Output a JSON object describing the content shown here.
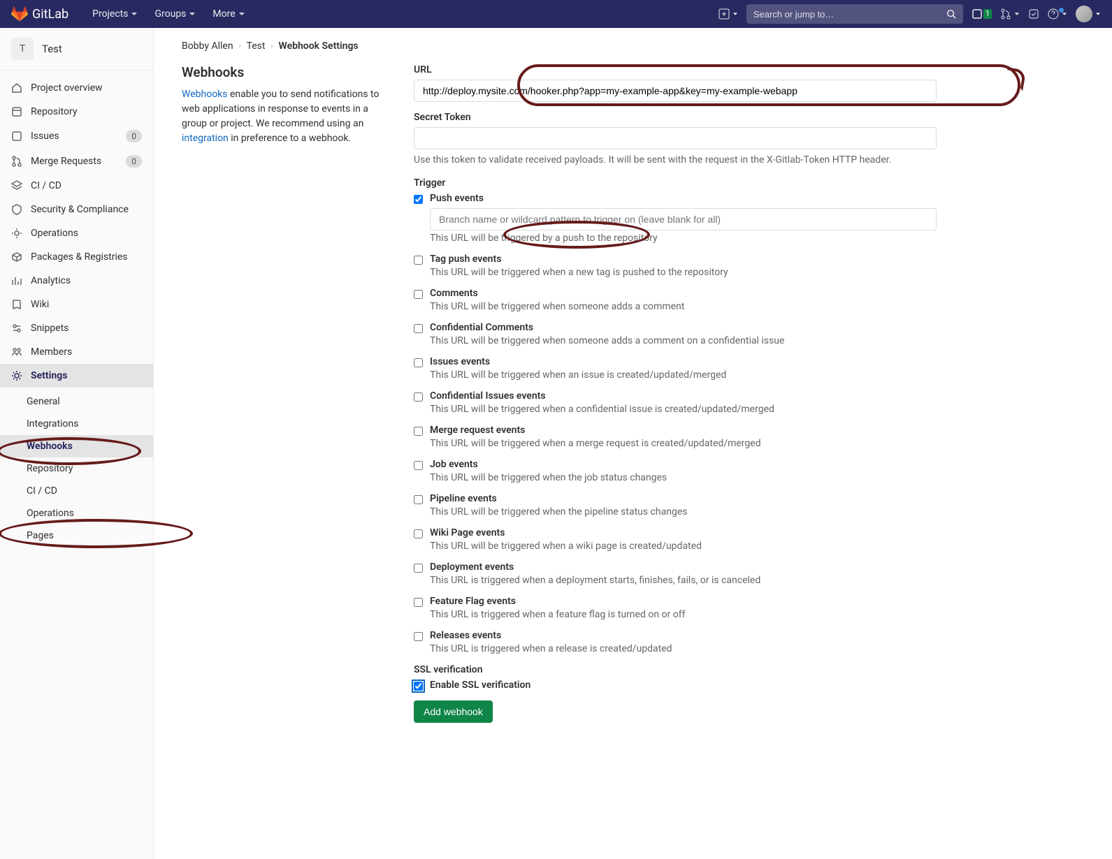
{
  "navbar": {
    "brand": "GitLab",
    "menu": [
      "Projects",
      "Groups",
      "More"
    ],
    "search_placeholder": "Search or jump to…",
    "todo_badge": "1"
  },
  "sidebar": {
    "project_initial": "T",
    "project_name": "Test",
    "items": [
      {
        "label": "Project overview",
        "badge": null
      },
      {
        "label": "Repository",
        "badge": null
      },
      {
        "label": "Issues",
        "badge": "0"
      },
      {
        "label": "Merge Requests",
        "badge": "0"
      },
      {
        "label": "CI / CD",
        "badge": null
      },
      {
        "label": "Security & Compliance",
        "badge": null
      },
      {
        "label": "Operations",
        "badge": null
      },
      {
        "label": "Packages & Registries",
        "badge": null
      },
      {
        "label": "Analytics",
        "badge": null
      },
      {
        "label": "Wiki",
        "badge": null
      },
      {
        "label": "Snippets",
        "badge": null
      },
      {
        "label": "Members",
        "badge": null
      },
      {
        "label": "Settings",
        "badge": null
      }
    ],
    "settings_sub": [
      "General",
      "Integrations",
      "Webhooks",
      "Repository",
      "CI / CD",
      "Operations",
      "Pages"
    ]
  },
  "breadcrumb": [
    "Bobby Allen",
    "Test",
    "Webhook Settings"
  ],
  "desc": {
    "heading": "Webhooks",
    "link1": "Webhooks",
    "text1": " enable you to send notifications to web applications in response to events in a group or project. We recommend using an ",
    "link2": "integration",
    "text2": " in preference to a webhook."
  },
  "form": {
    "url_label": "URL",
    "url_value": "http://deploy.mysite.com/hooker.php?app=my-example-app&key=my-example-webapp",
    "secret_label": "Secret Token",
    "secret_help": "Use this token to validate received payloads. It will be sent with the request in the X-Gitlab-Token HTTP header.",
    "trigger_label": "Trigger",
    "branch_placeholder": "Branch name or wildcard pattern to trigger on (leave blank for all)",
    "triggers": [
      {
        "label": "Push events",
        "desc": "This URL will be triggered by a push to the repository",
        "checked": true,
        "has_input": true
      },
      {
        "label": "Tag push events",
        "desc": "This URL will be triggered when a new tag is pushed to the repository",
        "checked": false
      },
      {
        "label": "Comments",
        "desc": "This URL will be triggered when someone adds a comment",
        "checked": false
      },
      {
        "label": "Confidential Comments",
        "desc": "This URL will be triggered when someone adds a comment on a confidential issue",
        "checked": false
      },
      {
        "label": "Issues events",
        "desc": "This URL will be triggered when an issue is created/updated/merged",
        "checked": false
      },
      {
        "label": "Confidential Issues events",
        "desc": "This URL will be triggered when a confidential issue is created/updated/merged",
        "checked": false
      },
      {
        "label": "Merge request events",
        "desc": "This URL will be triggered when a merge request is created/updated/merged",
        "checked": false
      },
      {
        "label": "Job events",
        "desc": "This URL will be triggered when the job status changes",
        "checked": false
      },
      {
        "label": "Pipeline events",
        "desc": "This URL will be triggered when the pipeline status changes",
        "checked": false
      },
      {
        "label": "Wiki Page events",
        "desc": "This URL will be triggered when a wiki page is created/updated",
        "checked": false
      },
      {
        "label": "Deployment events",
        "desc": "This URL is triggered when a deployment starts, finishes, fails, or is canceled",
        "checked": false
      },
      {
        "label": "Feature Flag events",
        "desc": "This URL is triggered when a feature flag is turned on or off",
        "checked": false
      },
      {
        "label": "Releases events",
        "desc": "This URL is triggered when a release is created/updated",
        "checked": false
      }
    ],
    "ssl_heading": "SSL verification",
    "ssl_label": "Enable SSL verification",
    "submit": "Add webhook"
  }
}
